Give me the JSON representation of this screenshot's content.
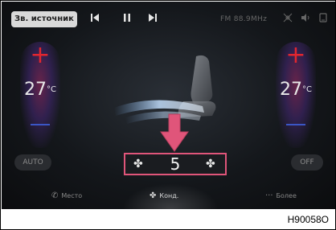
{
  "top_bar": {
    "source_label": "Зв. источник",
    "prev_icon": "skip-previous-icon",
    "pause_icon": "pause-icon",
    "next_icon": "skip-next-icon",
    "radio": "FM 88.9MHz",
    "icons": [
      "fan-off-icon",
      "volume-icon",
      "phone-icon"
    ]
  },
  "left_zone": {
    "plus": "+",
    "temperature": "27",
    "unit": "°C"
  },
  "right_zone": {
    "plus": "+",
    "temperature": "27",
    "unit": "°C"
  },
  "buttons": {
    "auto": "AUTO",
    "off": "OFF"
  },
  "fan": {
    "speed": "5"
  },
  "tabs": [
    {
      "label": "Место",
      "icon": "phone-icon"
    },
    {
      "label": "Конд.",
      "icon": "fan-icon"
    },
    {
      "label": "Более",
      "icon": "more-icon"
    }
  ],
  "caption": "H90058O",
  "colors": {
    "plus": "#e2262f",
    "minus": "#3b56c5",
    "highlight": "#e0557a"
  }
}
